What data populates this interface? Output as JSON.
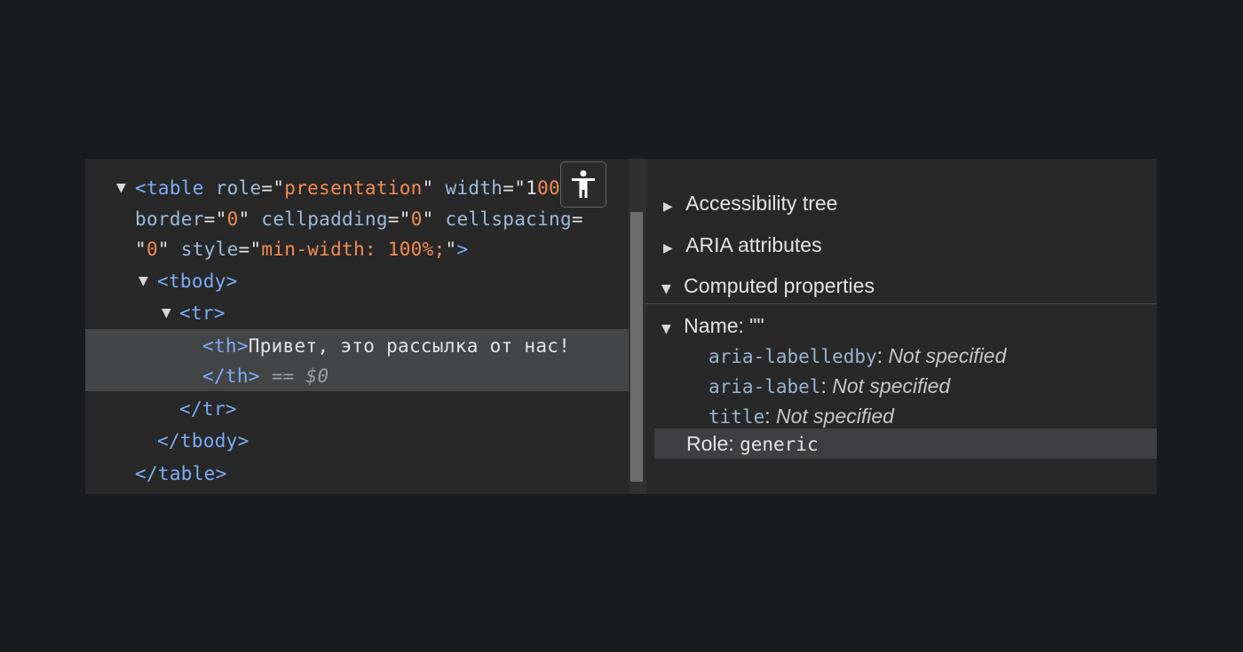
{
  "elements": {
    "table_open": {
      "tag_start": "<table",
      "attr_role": "role",
      "eq1": "=\"",
      "val_role": "presentation",
      "q1": "\"",
      "attr_width": "width",
      "eq2": "=\"1",
      "val_width": "00%",
      "q2": "\"",
      "attr_border": "border",
      "eq3": "=\"",
      "val_border": "0",
      "q3": "\"",
      "attr_cellpadding": "cellpadding",
      "eq4": "=\"",
      "val_cellpadding": "0",
      "q4": "\"",
      "attr_cellspacing": "cellspacing",
      "eq5": "=",
      "q5a": "\"",
      "val_cellspacing": "0",
      "q5b": "\"",
      "attr_style": "style",
      "eq6": "=\"",
      "val_style": "min-width: 100%;",
      "q6": "\"",
      "tag_close": ">"
    },
    "tbody_open": "<tbody>",
    "tr_open": "<tr>",
    "th_open": "<th>",
    "th_text": "Привет, это рассылка от нас!",
    "th_close": "</th>",
    "dollar_ref": "== $0",
    "tr_close": "</tr>",
    "tbody_close": "</tbody>",
    "table_close": "</table>",
    "accessibility_button_icon": "accessibility-icon"
  },
  "accessibility": {
    "sections": [
      {
        "label": "Accessibility tree",
        "expanded": false
      },
      {
        "label": "ARIA attributes",
        "expanded": false
      },
      {
        "label": "Computed properties",
        "expanded": true
      }
    ],
    "name_label": "Name: \"\"",
    "props": [
      {
        "key": "aria-labelledby",
        "sep": ": ",
        "value": "Not specified"
      },
      {
        "key": "aria-label",
        "sep": ": ",
        "value": "Not specified"
      },
      {
        "key": "title",
        "sep": ": ",
        "value": "Not specified"
      }
    ],
    "role_label": "Role: ",
    "role_value": "generic"
  },
  "colors": {
    "background": "#1a1b1f",
    "panel": "#282828",
    "tag": "#7cacf8",
    "attribute_value": "#f28b54",
    "selected_row": "#444547"
  }
}
